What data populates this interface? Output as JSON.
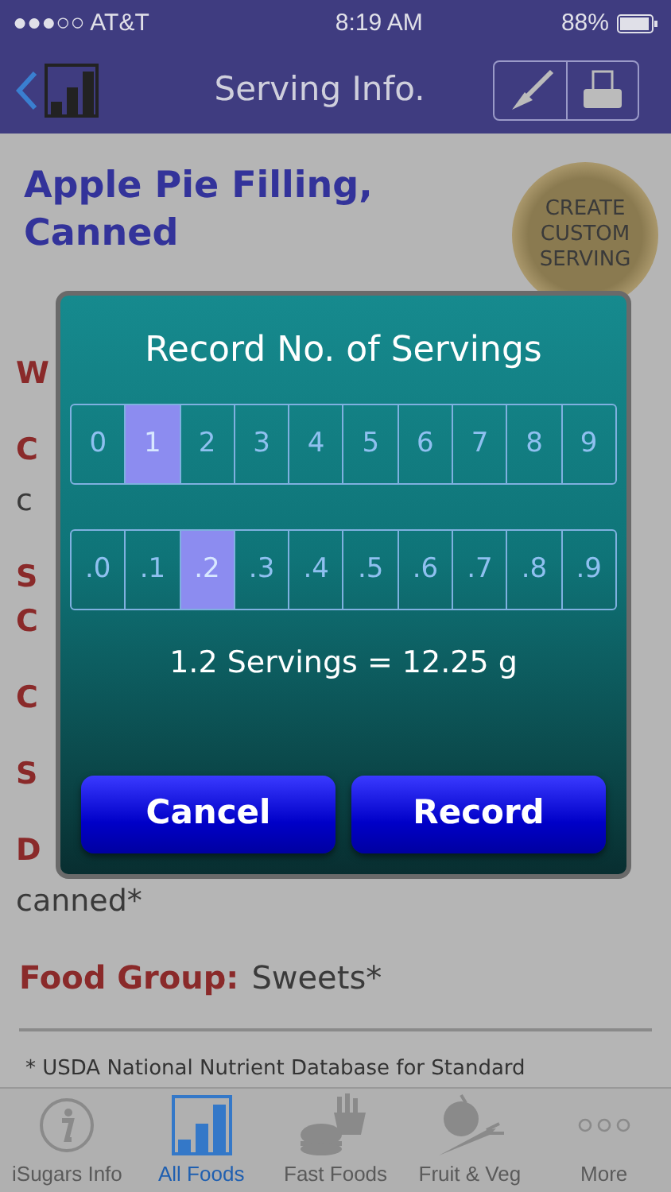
{
  "status_bar": {
    "carrier": "●●●○○ AT&T",
    "time": "8:19 AM",
    "battery": "88%"
  },
  "nav": {
    "title": "Serving Info."
  },
  "food": {
    "name": "Apple Pie Filling, Canned",
    "custom_button": "CREATE CUSTOM SERVING"
  },
  "background_lines": [
    {
      "kind": "label",
      "text": "W"
    },
    {
      "kind": "label",
      "text": "C"
    },
    {
      "kind": "value",
      "text": "c"
    },
    {
      "kind": "label",
      "text": "S"
    },
    {
      "kind": "label_line",
      "text": "C"
    },
    {
      "kind": "label",
      "text": "C"
    },
    {
      "kind": "label",
      "text": "S"
    },
    {
      "kind": "label",
      "text": "D"
    },
    {
      "kind": "value",
      "text": "canned*"
    }
  ],
  "food_group": {
    "label": "Food Group:",
    "value": "Sweets*"
  },
  "footnote": "* USDA National Nutrient Database for Standard",
  "dialog": {
    "title": "Record No. of Servings",
    "whole": [
      {
        "label": "0",
        "selected": false
      },
      {
        "label": "1",
        "selected": true
      },
      {
        "label": "2",
        "selected": false
      },
      {
        "label": "3",
        "selected": false
      },
      {
        "label": "4",
        "selected": false
      },
      {
        "label": "5",
        "selected": false
      },
      {
        "label": "6",
        "selected": false
      },
      {
        "label": "7",
        "selected": false
      },
      {
        "label": "8",
        "selected": false
      },
      {
        "label": "9",
        "selected": false
      }
    ],
    "fraction": [
      {
        "label": ".0",
        "selected": false
      },
      {
        "label": ".1",
        "selected": false
      },
      {
        "label": ".2",
        "selected": true
      },
      {
        "label": ".3",
        "selected": false
      },
      {
        "label": ".4",
        "selected": false
      },
      {
        "label": ".5",
        "selected": false
      },
      {
        "label": ".6",
        "selected": false
      },
      {
        "label": ".7",
        "selected": false
      },
      {
        "label": ".8",
        "selected": false
      },
      {
        "label": ".9",
        "selected": false
      }
    ],
    "result": "1.2 Servings = 12.25 g",
    "buttons": [
      "Cancel",
      "Record"
    ]
  },
  "tabs": [
    {
      "label": "iSugars Info",
      "selected": false
    },
    {
      "label": "All Foods",
      "selected": true
    },
    {
      "label": "Fast Foods",
      "selected": false
    },
    {
      "label": "Fruit & Veg",
      "selected": false
    },
    {
      "label": "More",
      "selected": false
    }
  ]
}
